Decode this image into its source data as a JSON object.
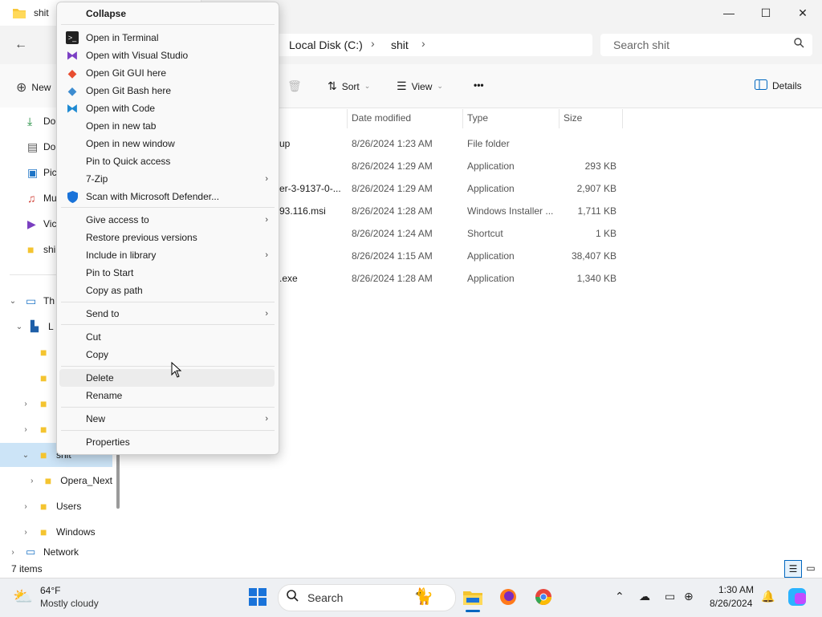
{
  "window": {
    "tab_title": "shit",
    "controls": {
      "minimize": "—",
      "maximize": "☐",
      "close": "✕"
    }
  },
  "address": {
    "back": "←",
    "crumbs": [
      "Local Disk (C:)",
      "shit"
    ],
    "sep": "›",
    "search_placeholder": "Search shit"
  },
  "toolbar": {
    "new_label": "New",
    "sort_label": "Sort",
    "view_label": "View",
    "more_label": "•••",
    "details_label": "Details"
  },
  "nav": {
    "items": [
      {
        "label": "Do",
        "icon": "download-icon"
      },
      {
        "label": "Do",
        "icon": "document-icon"
      },
      {
        "label": "Pic",
        "icon": "pictures-icon"
      },
      {
        "label": "Mu",
        "icon": "music-icon"
      },
      {
        "label": "Vic",
        "icon": "videos-icon"
      },
      {
        "label": "shi",
        "icon": "folder-icon"
      }
    ],
    "tree": [
      {
        "label": "Th",
        "chev": "⌄",
        "icon": "this-pc-icon"
      },
      {
        "label": "L",
        "chev": "⌄",
        "icon": "drive-icon"
      },
      {
        "label": "",
        "chev": "",
        "icon": "folder-icon"
      },
      {
        "label": "",
        "chev": "",
        "icon": "folder-icon"
      },
      {
        "label": "",
        "chev": "›",
        "icon": "folder-icon"
      },
      {
        "label": "",
        "chev": "›",
        "icon": "folder-icon"
      },
      {
        "label": "shit",
        "chev": "⌄",
        "icon": "folder-icon"
      },
      {
        "label": "Opera_Next",
        "chev": "›",
        "icon": "folder-icon"
      },
      {
        "label": "Users",
        "chev": "›",
        "icon": "folder-icon"
      },
      {
        "label": "Windows",
        "chev": "›",
        "icon": "folder-icon"
      },
      {
        "label": "Network",
        "chev": "›",
        "icon": "network-icon"
      }
    ]
  },
  "files": {
    "headers": [
      "Date modified",
      "Type",
      "Size"
    ],
    "rows": [
      {
        "name": "up",
        "date": "8/26/2024 1:23 AM",
        "type": "File folder",
        "size": ""
      },
      {
        "name": "",
        "date": "8/26/2024 1:29 AM",
        "type": "Application",
        "size": "293 KB"
      },
      {
        "name": "er-3-9137-0-...",
        "date": "8/26/2024 1:29 AM",
        "type": "Application",
        "size": "2,907 KB"
      },
      {
        "name": "93.116.msi",
        "date": "8/26/2024 1:28 AM",
        "type": "Windows Installer ...",
        "size": "1,711 KB"
      },
      {
        "name": "",
        "date": "8/26/2024 1:24 AM",
        "type": "Shortcut",
        "size": "1 KB"
      },
      {
        "name": "",
        "date": "8/26/2024 1:15 AM",
        "type": "Application",
        "size": "38,407 KB"
      },
      {
        "name": ".exe",
        "date": "8/26/2024 1:28 AM",
        "type": "Application",
        "size": "1,340 KB"
      }
    ]
  },
  "status": {
    "items_count": "7 items"
  },
  "menu": {
    "header": "Collapse",
    "items": [
      "Open in Terminal",
      "Open with Visual Studio",
      "Open Git GUI here",
      "Open Git Bash here",
      "Open with Code",
      "Open in new tab",
      "Open in new window",
      "Pin to Quick access",
      "7-Zip",
      "Scan with Microsoft Defender...",
      "Give access to",
      "Restore previous versions",
      "Include in library",
      "Pin to Start",
      "Copy as path",
      "Send to",
      "Cut",
      "Copy",
      "Delete",
      "Rename",
      "New",
      "Properties"
    ]
  },
  "taskbar": {
    "weather_temp": "64°F",
    "weather_desc": "Mostly cloudy",
    "search_label": "Search",
    "time": "1:30 AM",
    "date": "8/26/2024"
  },
  "colors": {
    "selection": "#cce4f7",
    "accent": "#0067c0"
  }
}
